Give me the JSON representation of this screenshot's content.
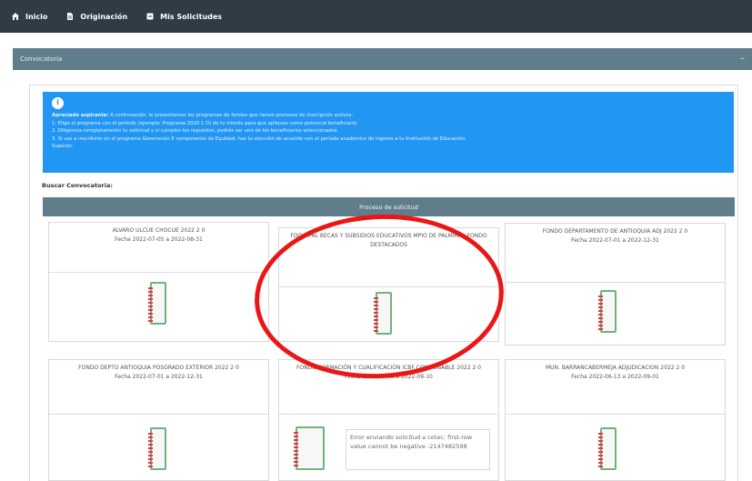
{
  "nav": {
    "items": [
      {
        "label": "Inicio",
        "icon": "home-icon"
      },
      {
        "label": "Originación",
        "icon": "document-icon"
      },
      {
        "label": "Mis Solicitudes",
        "icon": "folder-icon"
      }
    ]
  },
  "convocatoria": {
    "title": "Convocatoria",
    "collapse_symbol": "–"
  },
  "info": {
    "heading": "Apreciado aspirante:",
    "intro": "A continuación, le presentamos los programas de fondos que tienen procesos de inscripción activos:",
    "line1": "1. Elige el programa con el periodo (ejemplo: Programa 2020 1 O) de tu interés para que apliques como potencial beneficiario.",
    "line2": "2. Diligencia completamente tu solicitud y si cumples los requisitos, podrás ser uno de los beneficiarios seleccionados.",
    "line3": "3. Si vas a inscribirte en el programa Generación E componente de Equidad, haz tu elección de acuerdo con el periodo académico de ingreso a tu Institución de Educación",
    "line3b": "Superior."
  },
  "search": {
    "label": "Buscar Convocatoria:"
  },
  "process": {
    "title": "Proceso de solicitud"
  },
  "cards": [
    {
      "title": "ALVARO ULCUE CHOCUE 2022 2 0",
      "date": "Fecha 2022-07-05 a 2022-08-31"
    },
    {
      "title": "FDO MPAL BECAS Y SUBSIDIOS EDUCATIVOS MPIO DE PALMIRA - FONDO DESTACADOS",
      "date": ""
    },
    {
      "title": "FONDO DEPARTAMENTO DE ANTIOQUIA ADJ 2022 2 0",
      "date": "Fecha 2022-07-01 a 2022-12-31"
    },
    {
      "title": "FONDO DEPTO ANTIOQUIA POSGRADO EXTERIOR 2022 2 0",
      "date": "Fecha 2022-07-01 a 2022-12-31"
    },
    {
      "title": "FONDO FORMACIÓN Y CUALIFICACIÓN ICBF CONDONABLE 2022 2 0",
      "date": "Fecha 2022-06-08 a 2022-09-10"
    },
    {
      "title": "MUN. BARRANCABERMEJA ADJUDICACION 2022 2 0",
      "date": "Fecha 2022-06-13 a 2022-09-01"
    }
  ],
  "error": {
    "message": "Error enviando solicitud a cotec: first-row value cannot be negative -2147482598"
  },
  "colors": {
    "nav": "#2f3b45",
    "band": "#607d8b",
    "info": "#2196f3",
    "annotation": "#ea1717"
  }
}
